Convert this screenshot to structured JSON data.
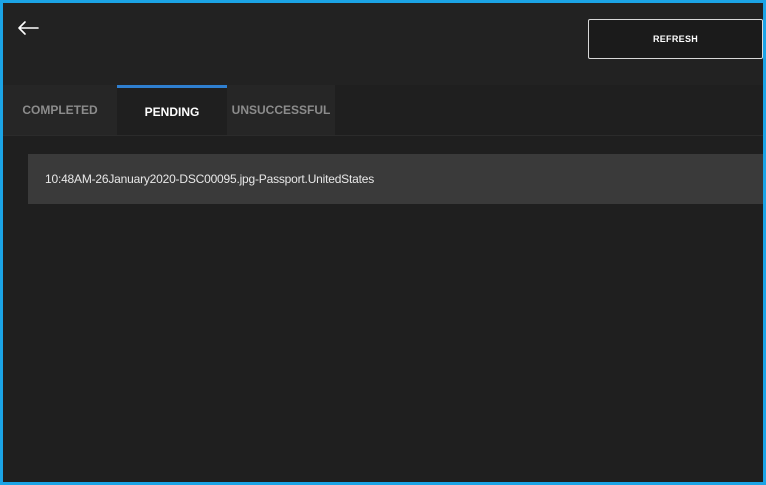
{
  "header": {
    "back_icon": "arrow-left-icon",
    "refresh_label": "REFRESH"
  },
  "tabs": [
    {
      "label": "COMPLETED",
      "active": false
    },
    {
      "label": "PENDING",
      "active": true
    },
    {
      "label": "UNSUCCESSFUL",
      "active": false
    }
  ],
  "queue": {
    "items": [
      {
        "label": "10:48AM-26January2020-DSC00095.jpg-Passport.UnitedStates"
      }
    ]
  },
  "colors": {
    "window_border": "#1ba4e6",
    "background": "#1f1f1f",
    "active_tab_indicator": "#2f7fd0",
    "list_item_background": "#3a3a3a"
  }
}
